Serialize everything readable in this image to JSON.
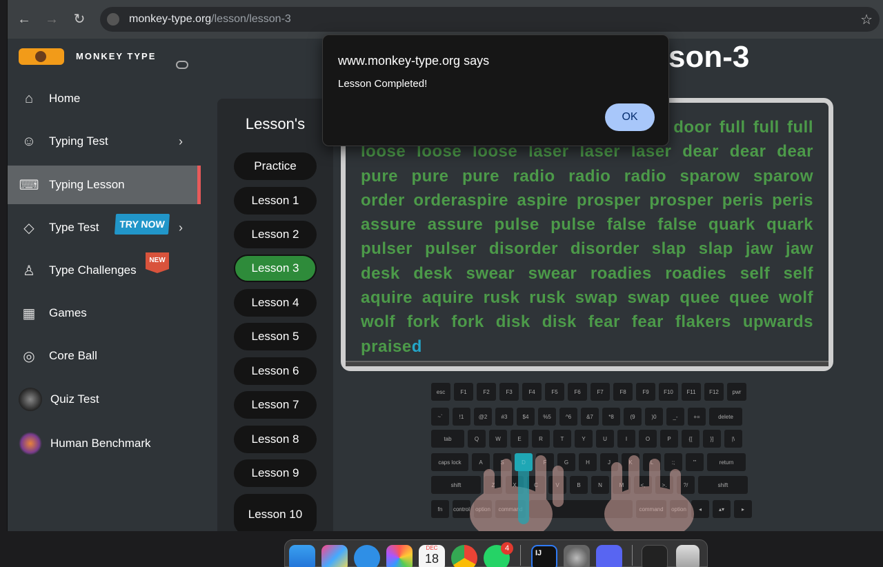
{
  "browser": {
    "url_host": "monkey-type.org",
    "url_path": "/lesson/lesson-3"
  },
  "brand": {
    "name": "MONKEY TYPE"
  },
  "sidebar": {
    "items": [
      {
        "label": "Home",
        "icon": "home-icon"
      },
      {
        "label": "Typing Test",
        "icon": "github-icon"
      },
      {
        "label": "Typing Lesson",
        "icon": "keyboard-icon"
      },
      {
        "label": "Type Test",
        "icon": "cat-icon",
        "badge": "TRY NOW"
      },
      {
        "label": "Type Challenges",
        "icon": "award-icon",
        "badge": "NEW"
      },
      {
        "label": "Games",
        "icon": "grid-icon"
      },
      {
        "label": "Core Ball",
        "icon": "target-icon"
      },
      {
        "label": "Quiz Test",
        "icon": "quiz-avatar"
      },
      {
        "label": "Human Benchmark",
        "icon": "brain-avatar"
      }
    ]
  },
  "lessons": {
    "title": "Lesson's",
    "items": [
      "Practice",
      "Lesson 1",
      "Lesson 2",
      "Lesson 3",
      "Lesson 4",
      "Lesson 5",
      "Lesson 6",
      "Lesson 7",
      "Lesson 8",
      "Lesson 9",
      "Lesson 10"
    ],
    "active": "Lesson 3"
  },
  "page": {
    "title_visible": "son-3"
  },
  "typing": {
    "line1_visible": "door full full full",
    "line2_visible": "loose loose loose laser laser laser dear dear dear",
    "body": "pure pure pure radio radio radio sparow sparow order orderaspire aspire prosper prosper peris peris assure assure pulse pulse false false quark quark pulser pulser disorder disorder slap slap jaw jaw desk desk swear swear roadies roadies self self aquire aquire rusk rusk swap swap quee quee wolf wolf fork fork disk disk fear fear flakers upwards praise",
    "cursor_char": "d",
    "typed_color": "#4c9a49",
    "cursor_color": "#23a6c9"
  },
  "keyboard": {
    "row0": [
      "esc",
      "F1",
      "F2",
      "F3",
      "F4",
      "F5",
      "F6",
      "F7",
      "F8",
      "F9",
      "F10",
      "F11",
      "F12",
      "pwr"
    ],
    "row1": [
      "~`",
      "!1",
      "@2",
      "#3",
      "$4",
      "%5",
      "^6",
      "&7",
      "*8",
      "(9",
      ")0",
      "_-",
      "+=",
      "delete"
    ],
    "row2": [
      "tab",
      "Q",
      "W",
      "E",
      "R",
      "T",
      "Y",
      "U",
      "I",
      "O",
      "P",
      "{[",
      "}]",
      "|\\"
    ],
    "row3": [
      "caps lock",
      "A",
      "S",
      "D",
      "F",
      "G",
      "H",
      "J",
      "K",
      "L",
      ":;",
      "\"'",
      "return"
    ],
    "row4": [
      "shift",
      "Z",
      "X",
      "C",
      "V",
      "B",
      "N",
      "M",
      "<,",
      ">.",
      "?/",
      "shift"
    ],
    "row5": [
      "fn",
      "control",
      "option",
      "command",
      "",
      "command",
      "option",
      "◂",
      "▴▾",
      "▸"
    ],
    "highlighted": "D"
  },
  "dialog": {
    "title": "www.monkey-type.org says",
    "message": "Lesson Completed!",
    "ok": "OK"
  },
  "dock": {
    "calendar_month": "DEC",
    "calendar_day": "18",
    "whatsapp_badge": "4"
  },
  "colors": {
    "accent_red": "#e85a5a",
    "active_lesson": "#2e8b3a",
    "ok_button": "#a8c7fa"
  }
}
